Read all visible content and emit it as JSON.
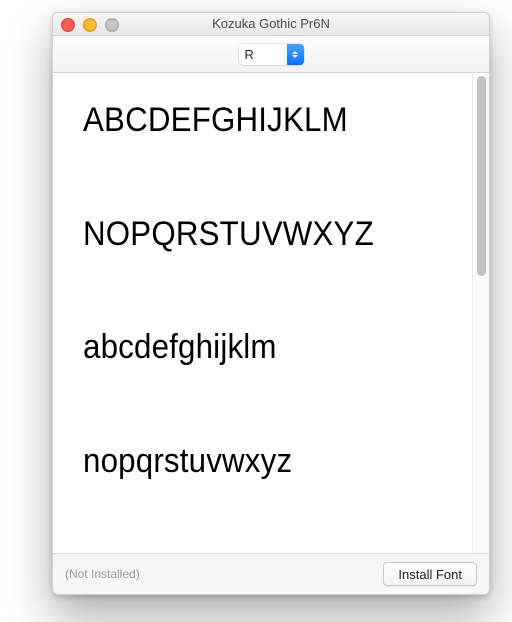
{
  "window": {
    "title": "Kozuka Gothic Pr6N"
  },
  "toolbar": {
    "style_select": {
      "value": "R"
    }
  },
  "preview": {
    "lines": [
      "ABCDEFGHIJKLM",
      "NOPQRSTUVWXYZ",
      "abcdefghijklm",
      "nopqrstuvwxyz"
    ]
  },
  "footer": {
    "status": "(Not Installed)",
    "install_label": "Install Font"
  }
}
